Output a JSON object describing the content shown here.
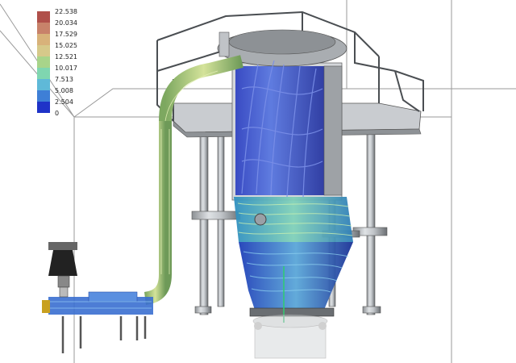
{
  "legend": {
    "labels": [
      "22.538",
      "20.034",
      "17.529",
      "15.025",
      "12.521",
      "10.017",
      "7.513",
      "5.008",
      "2.504",
      "0"
    ],
    "colors": [
      "#b0504a",
      "#c8826a",
      "#d8b27a",
      "#d6c98a",
      "#a8d48a",
      "#7fd6b0",
      "#5fb9d8",
      "#3e7fd6",
      "#1f33c8"
    ]
  },
  "colors": {
    "flow_low": "#1f33c8",
    "flow_mid": "#3aa0c8",
    "flow_high": "#a8d070",
    "steel": "#b8bcc0",
    "steel_dark": "#6a6e72",
    "domain_edge": "#9a9a9a"
  }
}
